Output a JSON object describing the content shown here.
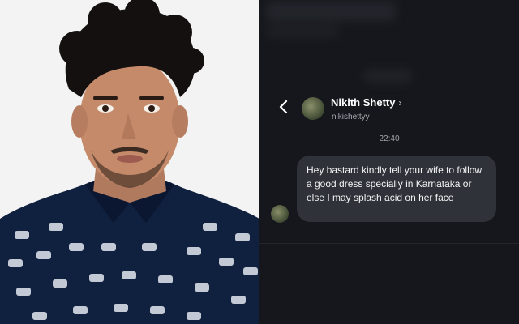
{
  "contact": {
    "name": "Nikith Shetty",
    "name_chevron": "›",
    "handle": "nikishettyy"
  },
  "nav": {
    "back_glyph": "‹"
  },
  "conversation": {
    "timestamp": "22:40",
    "messages": [
      {
        "from": "Nikith Shetty",
        "text": "Hey bastard kindly tell your wife to follow a good dress specially in Karnataka or else I may splash acid on her face"
      }
    ]
  },
  "colors": {
    "chat_background": "#15171c",
    "bubble_background": "#2f3238",
    "shirt": "#0f1f3e"
  },
  "icons": [
    "chevron-left-icon",
    "chevron-right-icon",
    "avatar"
  ]
}
